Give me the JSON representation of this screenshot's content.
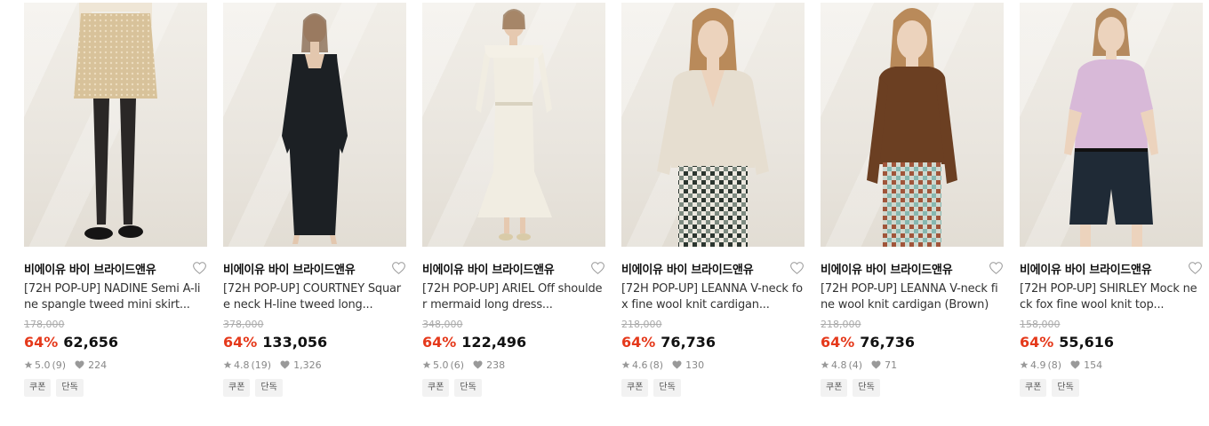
{
  "products": [
    {
      "brand": "비에이유 바이 브라이드앤유",
      "title": "[72H POP-UP] NADINE Semi A-line spangle tweed mini skirt...",
      "original_price": "178,000",
      "discount": "64%",
      "price": "62,656",
      "rating": "5.0",
      "reviews": "(9)",
      "likes": "224",
      "tags": [
        "쿠폰",
        "단독"
      ],
      "image_icon": "skirt-photo",
      "garment_color": "#d8c29a"
    },
    {
      "brand": "비에이유 바이 브라이드앤유",
      "title": "[72H POP-UP] COURTNEY Square neck H-line tweed long...",
      "original_price": "378,000",
      "discount": "64%",
      "price": "133,056",
      "rating": "4.8",
      "reviews": "(19)",
      "likes": "1,326",
      "tags": [
        "쿠폰",
        "단독"
      ],
      "image_icon": "dress-photo",
      "garment_color": "#1c2024"
    },
    {
      "brand": "비에이유 바이 브라이드앤유",
      "title": "[72H POP-UP] ARIEL Off shoulder mermaid long dress...",
      "original_price": "348,000",
      "discount": "64%",
      "price": "122,496",
      "rating": "5.0",
      "reviews": "(6)",
      "likes": "238",
      "tags": [
        "쿠폰",
        "단독"
      ],
      "image_icon": "dress-photo",
      "garment_color": "#f1ede2"
    },
    {
      "brand": "비에이유 바이 브라이드앤유",
      "title": "[72H POP-UP] LEANNA V-neck fox fine wool knit cardigan...",
      "original_price": "218,000",
      "discount": "64%",
      "price": "76,736",
      "rating": "4.6",
      "reviews": "(8)",
      "likes": "130",
      "tags": [
        "쿠폰",
        "단독"
      ],
      "image_icon": "cardigan-photo",
      "garment_color": "#e6ded0"
    },
    {
      "brand": "비에이유 바이 브라이드앤유",
      "title": "[72H POP-UP] LEANNA V-neck fine wool knit cardigan (Brown)",
      "original_price": "218,000",
      "discount": "64%",
      "price": "76,736",
      "rating": "4.8",
      "reviews": "(4)",
      "likes": "71",
      "tags": [
        "쿠폰",
        "단독"
      ],
      "image_icon": "cardigan-photo",
      "garment_color": "#6b3f22"
    },
    {
      "brand": "비에이유 바이 브라이드앤유",
      "title": "[72H POP-UP] SHIRLEY Mock neck fox fine wool knit top...",
      "original_price": "158,000",
      "discount": "64%",
      "price": "55,616",
      "rating": "4.9",
      "reviews": "(8)",
      "likes": "154",
      "tags": [
        "쿠폰",
        "단독"
      ],
      "image_icon": "knit-top-photo",
      "garment_color": "#d8b9d8"
    }
  ],
  "colors": {
    "discount": "#e5391b",
    "strike": "#aaaaaa",
    "tag_bg": "#f2f2f2"
  }
}
